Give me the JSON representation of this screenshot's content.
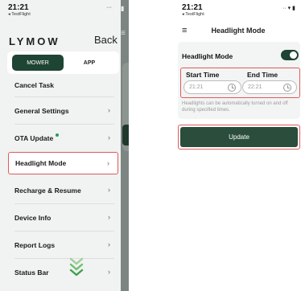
{
  "left": {
    "status": {
      "time": "21:21",
      "source": "◂ TestFlight"
    },
    "brand": "LYMOW",
    "back_label": "Back",
    "segment": {
      "active": "MOWER",
      "inactive": "APP"
    },
    "menu": [
      {
        "label": "Cancel Task"
      },
      {
        "label": "General Settings"
      },
      {
        "label": "OTA Update"
      },
      {
        "label": "Headlight Mode"
      },
      {
        "label": "Recharge & Resume"
      },
      {
        "label": "Device Info"
      },
      {
        "label": "Report Logs"
      },
      {
        "label": "Status Bar"
      }
    ],
    "chevron": "›",
    "accent": "#1e4433",
    "highlight_color": "#e05a5a"
  },
  "right": {
    "status": {
      "time": "21:21",
      "source": "◂ TestFlight"
    },
    "title": "Headlight Mode",
    "card": {
      "title": "Headlight Mode",
      "toggle_on": true,
      "start_label": "Start Time",
      "end_label": "End Time",
      "start_value": "21:21",
      "end_value": "22:21",
      "hint": "Headlights can be automatically turned on and off during specified times."
    },
    "update_label": "Update"
  }
}
